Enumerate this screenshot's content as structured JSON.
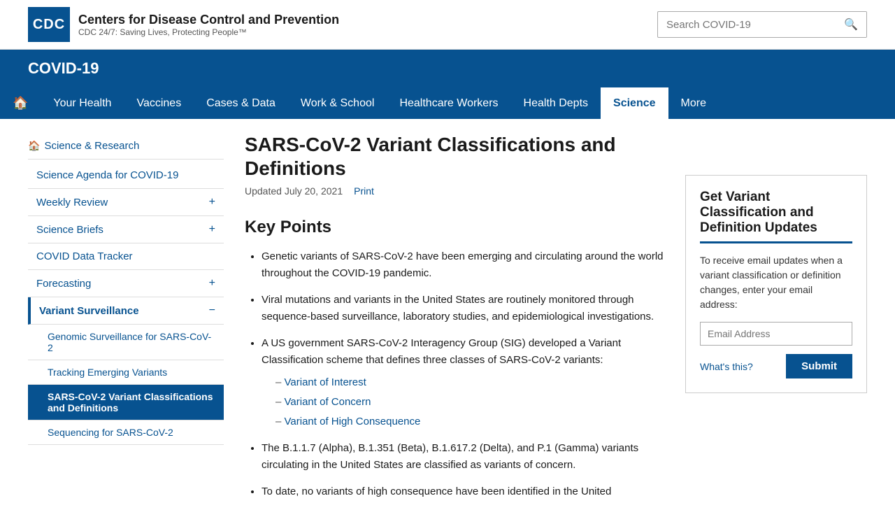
{
  "header": {
    "logo_text": "CDC",
    "org_name": "Centers for Disease Control and Prevention",
    "tagline": "CDC 24/7: Saving Lives, Protecting People™",
    "search_placeholder": "Search COVID-19"
  },
  "covid_banner": {
    "title": "COVID-19"
  },
  "nav": {
    "home_label": "Home",
    "items": [
      {
        "label": "Your Health",
        "active": false
      },
      {
        "label": "Vaccines",
        "active": false
      },
      {
        "label": "Cases & Data",
        "active": false
      },
      {
        "label": "Work & School",
        "active": false
      },
      {
        "label": "Healthcare Workers",
        "active": false
      },
      {
        "label": "Health Depts",
        "active": false
      },
      {
        "label": "Science",
        "active": true
      },
      {
        "label": "More",
        "active": false
      }
    ]
  },
  "sidebar": {
    "top_link": "Science & Research",
    "items": [
      {
        "label": "Science Agenda for COVID-19",
        "has_toggle": false,
        "expanded": false,
        "active": false
      },
      {
        "label": "Weekly Review",
        "has_toggle": true,
        "expanded": false,
        "active": false
      },
      {
        "label": "Science Briefs",
        "has_toggle": true,
        "expanded": false,
        "active": false
      },
      {
        "label": "COVID Data Tracker",
        "has_toggle": false,
        "expanded": false,
        "active": false
      },
      {
        "label": "Forecasting",
        "has_toggle": true,
        "expanded": false,
        "active": false
      },
      {
        "label": "Variant Surveillance",
        "has_toggle": true,
        "expanded": true,
        "active": false
      }
    ],
    "sub_items": [
      {
        "label": "Genomic Surveillance for SARS-CoV-2",
        "active": false
      },
      {
        "label": "Tracking Emerging Variants",
        "active": false
      },
      {
        "label": "SARS-CoV-2 Variant Classifications and Definitions",
        "active": true
      },
      {
        "label": "Sequencing for SARS-CoV-2",
        "active": false
      }
    ]
  },
  "page": {
    "title": "SARS-CoV-2 Variant Classifications and Definitions",
    "updated": "Updated July 20, 2021",
    "print_label": "Print",
    "section_heading": "Key Points",
    "bullet_1": "Genetic variants of SARS-CoV-2 have been emerging and circulating around the world throughout the COVID-19 pandemic.",
    "bullet_2": "Viral mutations and variants in the United States are routinely monitored through sequence-based surveillance, laboratory studies, and epidemiological investigations.",
    "bullet_3": "A US government SARS-CoV-2 Interagency Group (SIG) developed a Variant Classification scheme that defines three classes of SARS-CoV-2 variants:",
    "sub_item_1": "Variant of Interest",
    "sub_item_2": "Variant of Concern",
    "sub_item_3": "Variant of High Consequence",
    "bullet_4": "The B.1.1.7 (Alpha), B.1.351 (Beta), B.1.617.2 (Delta), and P.1 (Gamma) variants circulating in the United States are classified as variants of concern.",
    "bullet_5": "To date, no variants of high consequence have been identified in the United"
  },
  "update_box": {
    "title": "Get Variant Classification and Definition Updates",
    "description": "To receive email updates when a variant classification or definition changes, enter your email address:",
    "email_placeholder": "Email Address",
    "whats_this_label": "What's this?",
    "submit_label": "Submit"
  }
}
